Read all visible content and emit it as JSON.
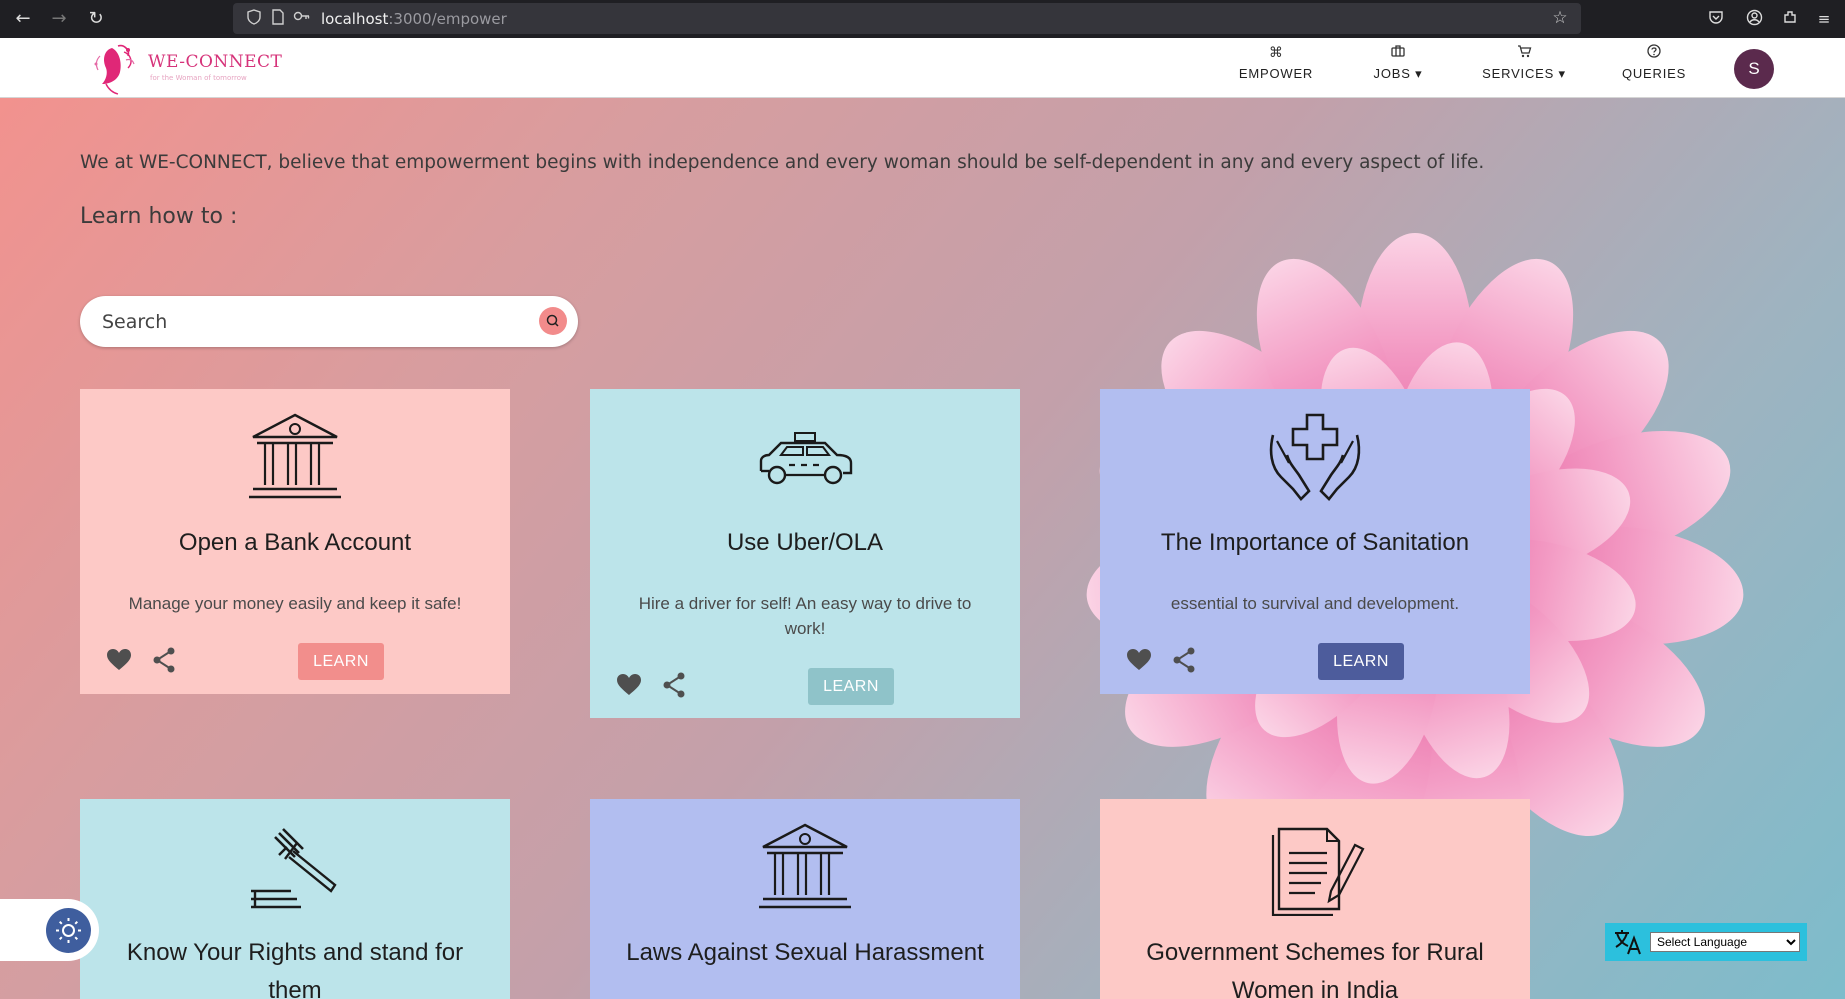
{
  "browser": {
    "url_host": "localhost",
    "url_path": ":3000/empower",
    "back_icon": "arrow-left-icon",
    "forward_icon": "arrow-right-icon",
    "reload_icon": "reload-icon"
  },
  "header": {
    "brand": "WE-CONNECT",
    "tagline": "for the Woman of tomorrow",
    "nav": [
      {
        "label": "EMPOWER",
        "icon": "command-icon"
      },
      {
        "label": "JOBS ▾",
        "icon": "briefcase-icon"
      },
      {
        "label": "SERVICES ▾",
        "icon": "cart-icon"
      },
      {
        "label": "QUERIES",
        "icon": "question-icon"
      }
    ],
    "avatar_initial": "S",
    "avatar_color": "#5b2a4d"
  },
  "main": {
    "intro": "We at WE-CONNECT, believe that empowerment begins with independence and every woman should be self-dependent in any and every aspect of life.",
    "learn_heading": "Learn how to :",
    "search_placeholder": "Search"
  },
  "cards": [
    {
      "title": "Open a Bank Account",
      "desc": "Manage your money easily and keep it safe!",
      "button": "LEARN",
      "icon": "bank-icon",
      "bg": "#fdc9c6",
      "btn": "#f28e8c"
    },
    {
      "title": "Use Uber/OLA",
      "desc": "Hire a driver for self! An easy way to drive to work!",
      "button": "LEARN",
      "icon": "taxi-icon",
      "bg": "#bce4ea",
      "btn": "#8fc3c9"
    },
    {
      "title": "The Importance of Sanitation",
      "desc": "essential to survival and development.",
      "button": "LEARN",
      "icon": "health-hands-icon",
      "bg": "#b2bef0",
      "btn": "#4d5c9c"
    },
    {
      "title": "Know Your Rights and stand for them",
      "desc": "",
      "button": "",
      "icon": "gavel-icon",
      "bg": "#bce4ea",
      "btn": ""
    },
    {
      "title": "Laws Against Sexual Harassment",
      "desc": "",
      "button": "",
      "icon": "bank-icon",
      "bg": "#b2bef0",
      "btn": ""
    },
    {
      "title": "Government Schemes for Rural Women in India",
      "desc": "",
      "button": "",
      "icon": "document-pen-icon",
      "bg": "#fdc9c6",
      "btn": ""
    }
  ],
  "widgets": {
    "theme_icon": "sun-icon",
    "translate_icon": "translate-icon",
    "language_select": "Select Language"
  }
}
